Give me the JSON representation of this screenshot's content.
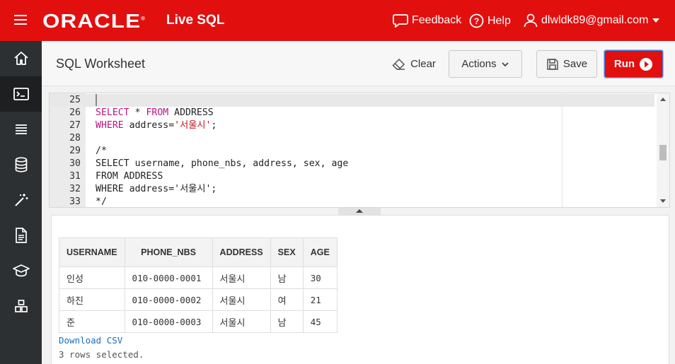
{
  "topbar": {
    "brand": "ORACLE",
    "app_name": "Live SQL",
    "feedback": "Feedback",
    "help": "Help",
    "user": "dlwldk89@gmail.com",
    "colors": {
      "bar": "#e20f0f"
    }
  },
  "sidebar": {
    "items": [
      {
        "icon": "home-icon"
      },
      {
        "icon": "terminal-icon",
        "active": true
      },
      {
        "icon": "list-icon"
      },
      {
        "icon": "database-icon"
      },
      {
        "icon": "magic-wand-icon"
      },
      {
        "icon": "document-icon"
      },
      {
        "icon": "graduation-cap-icon"
      },
      {
        "icon": "schema-icon"
      }
    ]
  },
  "header": {
    "title": "SQL Worksheet",
    "clear_label": "Clear",
    "actions_label": "Actions",
    "save_label": "Save",
    "run_label": "Run"
  },
  "editor": {
    "lines": [
      {
        "n": "25",
        "text": ""
      },
      {
        "n": "26",
        "text": "SELECT * FROM ADDRESS"
      },
      {
        "n": "27",
        "text": "WHERE address='서울시';"
      },
      {
        "n": "28",
        "text": ""
      },
      {
        "n": "29",
        "text": "/*"
      },
      {
        "n": "30",
        "text": "SELECT username, phone_nbs, address, sex, age"
      },
      {
        "n": "31",
        "text": "FROM ADDRESS"
      },
      {
        "n": "32",
        "text": "WHERE address='서울시';"
      },
      {
        "n": "33",
        "text": "*/"
      }
    ]
  },
  "results": {
    "columns": [
      "USERNAME",
      "PHONE_NBS",
      "ADDRESS",
      "SEX",
      "AGE"
    ],
    "rows": [
      [
        "인성",
        "010-0000-0001",
        "서울시",
        "남",
        "30"
      ],
      [
        "하진",
        "010-0000-0002",
        "서울시",
        "여",
        "21"
      ],
      [
        "준",
        "010-0000-0003",
        "서울시",
        "남",
        "45"
      ]
    ],
    "download_label": "Download CSV",
    "rows_selected": "3 rows selected."
  }
}
